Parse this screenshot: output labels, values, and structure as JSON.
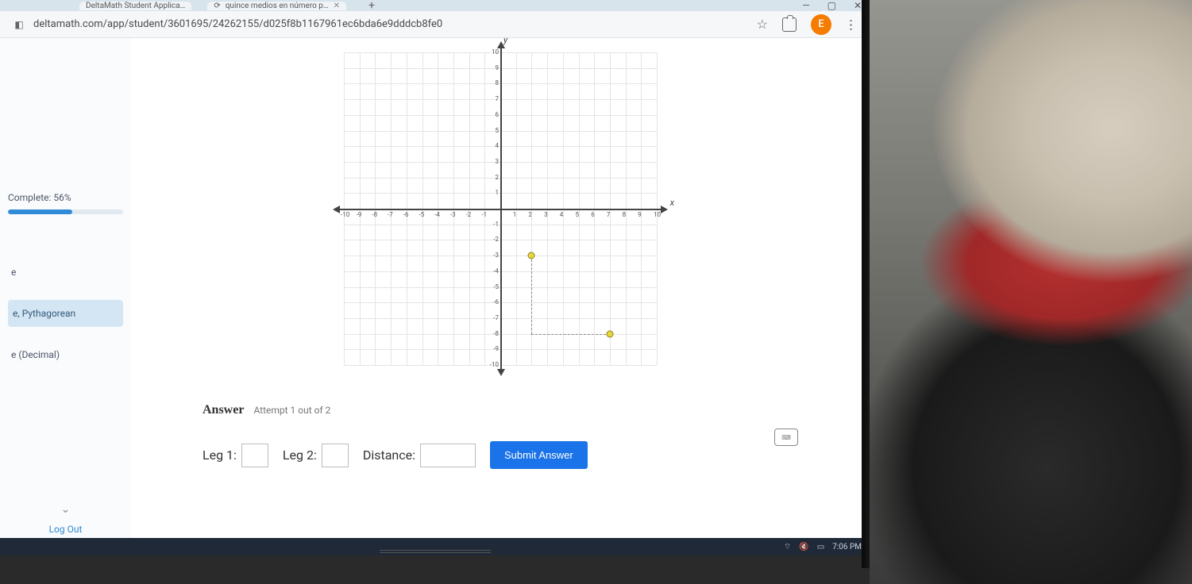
{
  "browser": {
    "tab1_title": "DeltaMath Student Applica…",
    "tab2_title": "quince medios en número p…",
    "url": "deltamath.com/app/student/3601695/24262155/d025f8b1167961ec6bda6e9dddcb8fe0",
    "avatar_letter": "E"
  },
  "sidebar": {
    "complete_label": "Complete: 56%",
    "progress_percent": 56,
    "item_e": "e",
    "item_active": "e, Pythagorean",
    "item_decimal": "e (Decimal)",
    "logout": "Log Out"
  },
  "chart_data": {
    "type": "scatter",
    "title": "",
    "xlabel": "x",
    "ylabel": "y",
    "xlim": [
      -10,
      10
    ],
    "ylim": [
      -10,
      10
    ],
    "x_ticks": [
      -10,
      -9,
      -8,
      -7,
      -6,
      -5,
      -4,
      -3,
      -2,
      -1,
      1,
      2,
      3,
      4,
      5,
      6,
      7,
      8,
      9,
      10
    ],
    "y_ticks": [
      -10,
      -9,
      -8,
      -7,
      -6,
      -5,
      -4,
      -3,
      -2,
      -1,
      1,
      2,
      3,
      4,
      5,
      6,
      7,
      8,
      9,
      10
    ],
    "points": [
      {
        "x": 2,
        "y": -3
      },
      {
        "x": 7,
        "y": -8
      }
    ],
    "dashed_segments": [
      {
        "from": {
          "x": 2,
          "y": -3
        },
        "to": {
          "x": 2,
          "y": -8
        }
      },
      {
        "from": {
          "x": 2,
          "y": -8
        },
        "to": {
          "x": 7,
          "y": -8
        }
      }
    ]
  },
  "answer": {
    "title": "Answer",
    "attempt": "Attempt 1 out of 2",
    "leg1_label": "Leg 1:",
    "leg2_label": "Leg 2:",
    "distance_label": "Distance:",
    "submit": "Submit Answer",
    "leg1_value": "",
    "leg2_value": "",
    "distance_value": ""
  },
  "taskbar": {
    "time": "7:06 PM"
  }
}
